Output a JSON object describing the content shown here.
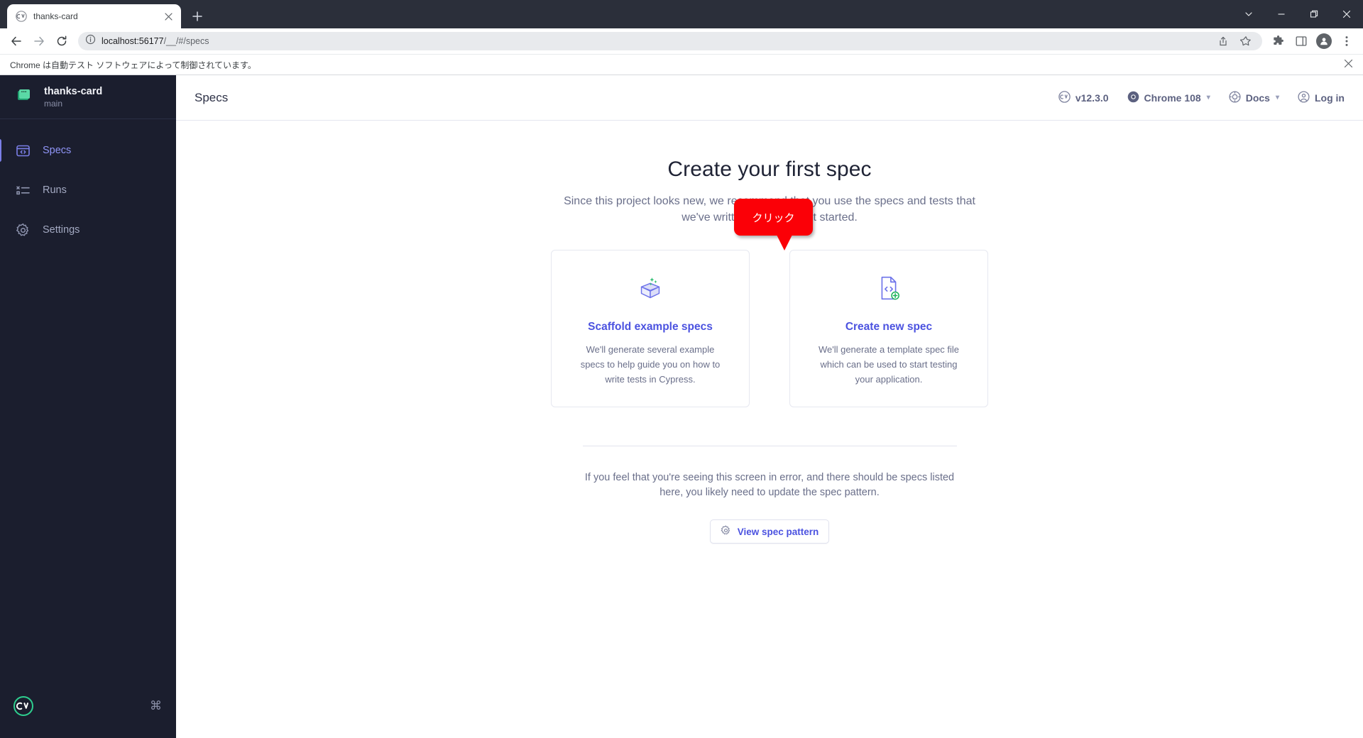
{
  "browser": {
    "tab": {
      "title": "thanks-card",
      "favicon_icon": "cypress-favicon",
      "close_icon": "close-icon"
    },
    "new_tab_icon": "plus-icon",
    "window_controls": [
      {
        "name": "tab-search",
        "icon": "chevron-down-icon"
      },
      {
        "name": "minimize",
        "icon": "minimize-icon"
      },
      {
        "name": "maximize",
        "icon": "restore-icon"
      },
      {
        "name": "close",
        "icon": "close-icon"
      }
    ],
    "toolbar": {
      "back_icon": "back-arrow-icon",
      "forward_icon": "forward-arrow-icon",
      "reload_icon": "reload-icon",
      "site_info_icon": "info-circle-icon",
      "url_host": "localhost:56177",
      "url_path": "/__/#/specs",
      "share_icon": "share-icon",
      "bookmark_icon": "star-icon",
      "extensions_icon": "puzzle-icon",
      "side_panel_icon": "side-panel-icon",
      "profile_icon": "profile-avatar-icon",
      "menu_icon": "three-dot-menu-icon"
    },
    "infobar": {
      "text": "Chrome は自動テスト ソフトウェアによって制御されています。",
      "close_icon": "close-icon"
    }
  },
  "sidebar": {
    "project_name": "thanks-card",
    "project_branch": "main",
    "project_icon": "project-chip-icon",
    "items": [
      {
        "label": "Specs",
        "icon": "specs-icon",
        "active": true
      },
      {
        "label": "Runs",
        "icon": "runs-icon",
        "active": false
      },
      {
        "label": "Settings",
        "icon": "gear-icon",
        "active": false
      }
    ],
    "footer": {
      "logo_icon": "cypress-logo-icon",
      "shortcut_icon": "command-key-icon",
      "shortcut_glyph": "⌘"
    }
  },
  "header": {
    "title": "Specs",
    "version": {
      "label": "v12.3.0",
      "icon": "cypress-icon"
    },
    "browser_select": {
      "label": "Chrome 108",
      "icon": "chrome-icon",
      "chevron": "▾"
    },
    "docs": {
      "label": "Docs",
      "icon": "docs-icon",
      "chevron": "▾"
    },
    "login": {
      "label": "Log in",
      "icon": "user-circle-icon"
    }
  },
  "main": {
    "heading": "Create your first spec",
    "subheading": "Since this project looks new, we recommend that you use the specs and tests that we've written for you to get started.",
    "cards": [
      {
        "icon": "scaffold-box-icon",
        "title": "Scaffold example specs",
        "description": "We'll generate several example specs to help guide you on how to write tests in Cypress."
      },
      {
        "icon": "new-spec-file-icon",
        "title": "Create new spec",
        "description": "We'll generate a template spec file which can be used to start testing your application."
      }
    ],
    "tooltip": {
      "text": "クリック",
      "color": "#fb0007"
    },
    "footer_note": "If you feel that you're seeing this screen in error, and there should be specs listed here, you likely need to update the spec pattern.",
    "pattern_button": {
      "label": "View spec pattern",
      "icon": "gear-icon"
    }
  },
  "colors": {
    "accent_purple": "#4b52e0",
    "sidebar_bg": "#1b1e2e",
    "tooltip_red": "#fb0007",
    "green": "#1cb35c"
  }
}
